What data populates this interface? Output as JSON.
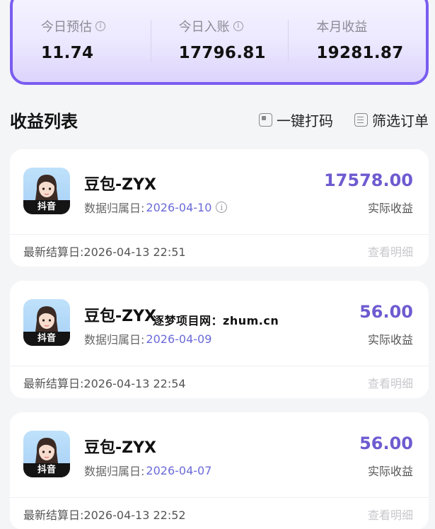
{
  "summary": {
    "items": [
      {
        "label": "今日预估",
        "value": "11.74"
      },
      {
        "label": "今日入账",
        "value": "17796.81"
      },
      {
        "label": "本月收益",
        "value": "19281.87"
      }
    ],
    "info_icon_glyph": "i"
  },
  "section": {
    "title": "收益列表",
    "action_code": "一键打码",
    "action_filter": "筛选订单"
  },
  "cards": [
    {
      "avatar_tag": "抖音",
      "name": "豆包-ZYX",
      "date_label": "数据归属日:",
      "date": "2026-04-10",
      "amount": "17578.00",
      "amount_label": "实际收益",
      "settle": "最新结算日:2026-04-13 22:51",
      "detail": "查看明细"
    },
    {
      "avatar_tag": "抖音",
      "name": "豆包-ZYX",
      "date_label": "数据归属日:",
      "date": "2026-04-09",
      "amount": "56.00",
      "amount_label": "实际收益",
      "settle": "最新结算日:2026-04-13 22:54",
      "detail": "查看明细"
    },
    {
      "avatar_tag": "抖音",
      "name": "豆包-ZYX",
      "date_label": "数据归属日:",
      "date": "2026-04-07",
      "amount": "56.00",
      "amount_label": "实际收益",
      "settle": "最新结算日:2026-04-13 22:52",
      "detail": "查看明细"
    }
  ],
  "watermark": "逐梦项目网：zhum.cn",
  "colors": {
    "accent": "#7a5cf0",
    "amount": "#6e5bd0",
    "date": "#6a6ad8"
  }
}
